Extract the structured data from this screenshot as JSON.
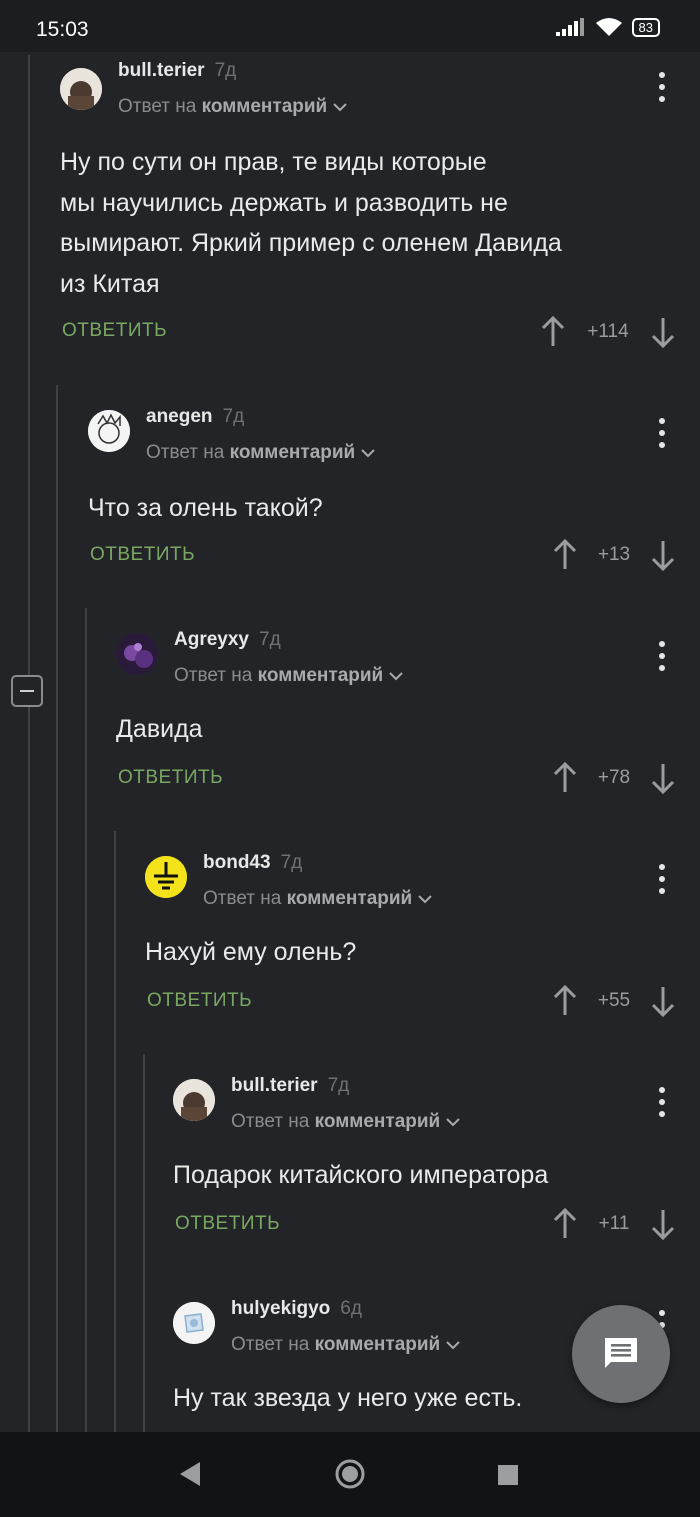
{
  "status_bar": {
    "time": "15:03",
    "battery": "83"
  },
  "reply_to_prefix": "Ответ на",
  "reply_to_target": "комментарий",
  "reply_label": "ОТВЕТИТЬ",
  "comments": [
    {
      "username": "bull.terier",
      "age": "7д",
      "lines": [
        "Ну по сути он прав, те виды которые",
        "мы научились держать и разводить не",
        "вымирают. Яркий пример с оленем Давида",
        "из Китая"
      ],
      "votes": "+114"
    },
    {
      "username": "anegen",
      "age": "7д",
      "lines": [
        "Что за олень такой?"
      ],
      "votes": "+13"
    },
    {
      "username": "Agreyxy",
      "age": "7д",
      "lines": [
        "Давида"
      ],
      "votes": "+78"
    },
    {
      "username": "bond43",
      "age": "7д",
      "lines": [
        "Нахуй ему олень?"
      ],
      "votes": "+55"
    },
    {
      "username": "bull.terier",
      "age": "7д",
      "lines": [
        "Подарок китайского императора"
      ],
      "votes": "+11"
    },
    {
      "username": "hulyekigyo",
      "age": "6д",
      "lines": [
        "Ну так звезда у него уже есть."
      ],
      "votes": ""
    }
  ],
  "icons": {
    "signal": "signal-icon",
    "wifi": "wifi-icon",
    "battery": "battery-icon",
    "menu": "more-vert-icon",
    "upvote": "arrow-up-icon",
    "downvote": "arrow-down-icon",
    "fab": "comment-icon",
    "nav_back": "back-triangle-icon",
    "nav_home": "home-circle-icon",
    "nav_recent": "recents-square-icon"
  },
  "colors": {
    "background": "#222428",
    "reply_green": "#7aa862",
    "muted": "#8a8c90"
  }
}
